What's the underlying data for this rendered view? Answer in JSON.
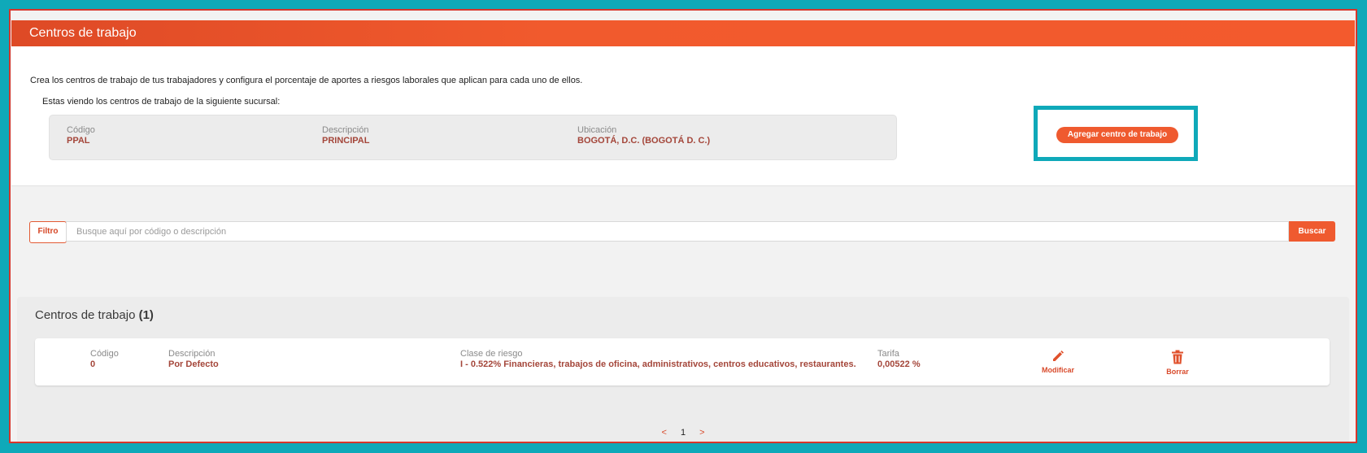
{
  "header": {
    "title": "Centros de trabajo"
  },
  "intro": {
    "text": "Crea los centros de trabajo de tus trabajadores y configura el porcentaje de aportes a riesgos laborales que aplican para cada uno de ellos.",
    "sucursal_label": "Estas viendo los centros de trabajo de la siguiente sucursal:"
  },
  "sucursal": {
    "codigo_label": "Código",
    "codigo": "PPAL",
    "descripcion_label": "Descripción",
    "descripcion": "PRINCIPAL",
    "ubicacion_label": "Ubicación",
    "ubicacion": "BOGOTÁ, D.C. (BOGOTÁ D. C.)"
  },
  "add_button": "Agregar centro de trabajo",
  "filter": {
    "tag": "Filtro",
    "placeholder": "Busque aquí por código o descripción",
    "search_button": "Buscar"
  },
  "list": {
    "title": "Centros de trabajo",
    "count": "(1)",
    "rows": [
      {
        "codigo_label": "Código",
        "codigo": "0",
        "descripcion_label": "Descripción",
        "descripcion": "Por Defecto",
        "clase_label": "Clase de riesgo",
        "clase": "I - 0.522% Financieras, trabajos de oficina, administrativos, centros educativos, restaurantes.",
        "tarifa_label": "Tarifa",
        "tarifa": "0,00522 %",
        "modificar": "Modificar",
        "borrar": "Borrar"
      }
    ]
  },
  "pagination": {
    "prev": "<",
    "current": "1",
    "next": ">"
  },
  "colors": {
    "accent": "#ef5a2f",
    "value_text": "#a4463a",
    "highlight": "#0fa9b9"
  }
}
